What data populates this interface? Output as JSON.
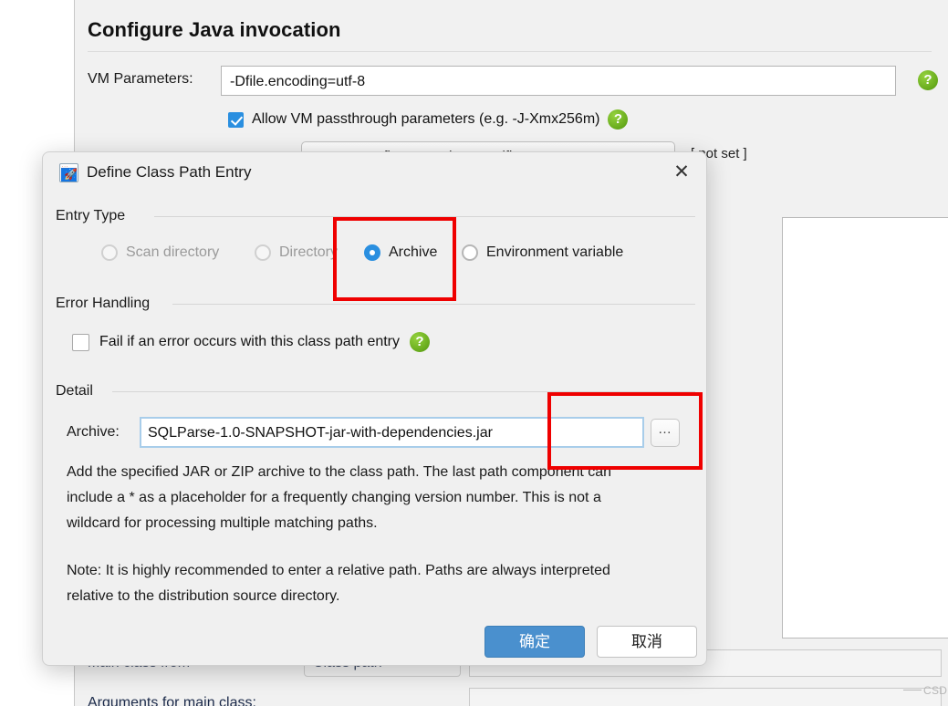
{
  "background": {
    "page_title": "Configure Java invocation",
    "vm_parameters": {
      "label": "VM Parameters:",
      "value": "-Dfile.encoding=utf-8",
      "help_icon": "help-icon"
    },
    "allow_passthrough": {
      "label": "Allow VM passthrough parameters (e.g. -J-Xmx256m)",
      "checked": true,
      "help_icon": "help-icon"
    },
    "version_specific_button": {
      "label": "Configure Version Specific VM Parameters",
      "note": "[ not set ]"
    },
    "side_buttons": [
      {
        "name": "add-entry-button",
        "icon": "plus-icon",
        "enabled": true
      },
      {
        "name": "edit-entry-button",
        "icon": "edit-note-icon",
        "enabled": false
      },
      {
        "name": "delete-entry-button",
        "icon": "close-x-icon",
        "enabled": false
      },
      {
        "name": "move-up-button",
        "icon": "chevron-up-icon",
        "enabled": false
      },
      {
        "name": "move-down-button",
        "icon": "chevron-down-icon",
        "enabled": false
      }
    ],
    "main_class_from": {
      "label": "Main class from",
      "value": "Class path"
    },
    "arguments_label": "Arguments for main class:",
    "browse_label": "…",
    "watermark": "CSDN @风_间"
  },
  "dialog": {
    "title": "Define Class Path Entry",
    "app_icon": "rocket-icon",
    "close_label": "✕",
    "entry_type": {
      "group_label": "Entry Type",
      "options": [
        {
          "label": "Scan directory",
          "selected": false,
          "enabled": false
        },
        {
          "label": "Directory",
          "selected": false,
          "enabled": false
        },
        {
          "label": "Archive",
          "selected": true,
          "enabled": true
        },
        {
          "label": "Environment variable",
          "selected": false,
          "enabled": true
        }
      ]
    },
    "error_handling": {
      "group_label": "Error Handling",
      "checkbox_label": "Fail if an error occurs with this class path entry",
      "checked": false,
      "help_icon": "help-icon"
    },
    "detail": {
      "group_label": "Detail",
      "archive_label": "Archive:",
      "archive_value": "SQLParse-1.0-SNAPSHOT-jar-with-dependencies.jar",
      "browse_label": "…",
      "description_1": "Add the specified JAR or ZIP archive to the class path. The last path component can include a * as a placeholder for a frequently changing version number. This is not a wildcard for processing multiple matching paths.",
      "description_2": "Note: It is highly recommended to enter a relative path. Paths are always interpreted relative to the distribution source directory."
    },
    "buttons": {
      "ok": "确定",
      "cancel": "取消"
    }
  },
  "annotations": {
    "colors": {
      "highlight": "#ef0000",
      "accent": "#2a8fe0",
      "ok_button": "#4a90ce"
    },
    "boxes": [
      {
        "name": "entry-type-highlight"
      },
      {
        "name": "archive-field-highlight"
      }
    ]
  }
}
